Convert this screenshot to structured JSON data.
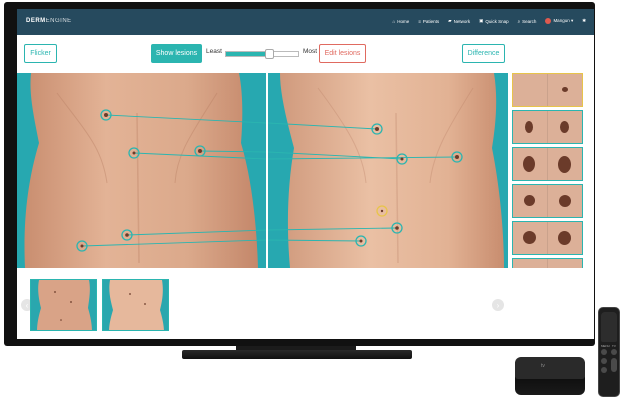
{
  "app": {
    "logo_bold": "DERM",
    "logo_light": "ENGINE"
  },
  "nav": {
    "items": [
      {
        "icon": "home-icon",
        "glyph": "⌂",
        "label": "Home"
      },
      {
        "icon": "patients-icon",
        "glyph": "≡",
        "label": "Patients"
      },
      {
        "icon": "network-icon",
        "glyph": "▰",
        "label": "Network"
      },
      {
        "icon": "quick-snap-icon",
        "glyph": "▣",
        "label": "Quick Snap"
      },
      {
        "icon": "search-icon",
        "glyph": "⌕",
        "label": "Search"
      },
      {
        "icon": "user-icon",
        "glyph": "",
        "label": "Mangun ▾"
      },
      {
        "icon": "gear-icon",
        "glyph": "✱",
        "label": ""
      }
    ]
  },
  "toolbar": {
    "flicker_label": "Flicker",
    "show_lesions_label": "Show lesions",
    "slider_min_label": "Least",
    "slider_max_label": "Most",
    "slider_value": 0.6,
    "edit_lesions_label": "Edit lesions",
    "difference_label": "Difference"
  },
  "colors": {
    "topbar": "#264a5e",
    "accent": "#2bb5b0",
    "danger": "#e06a60",
    "selected": "#e8c44a",
    "backdrop": "#27a8b0"
  },
  "nav_arrows": {
    "prev_glyph": "‹",
    "next_glyph": "›"
  },
  "remote": {
    "menu_label": "MENU",
    "tv_label": "TV"
  },
  "box": {
    "logo": "tv"
  }
}
